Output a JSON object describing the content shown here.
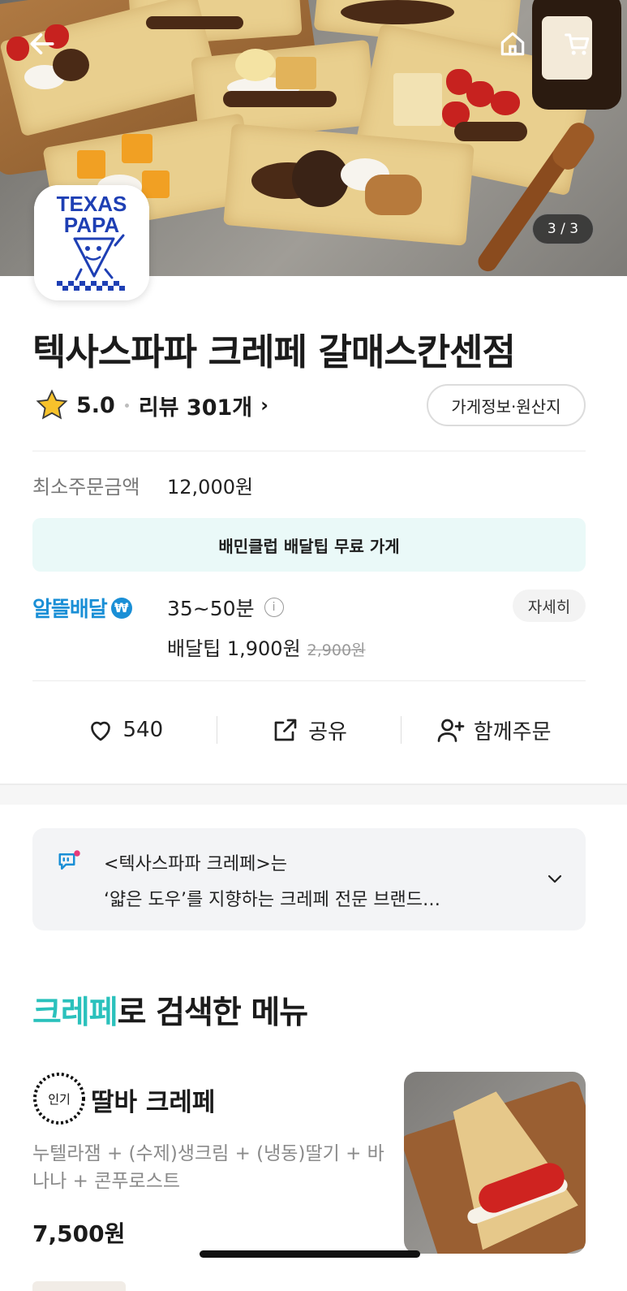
{
  "hero": {
    "page_counter": "3 / 3",
    "back_icon": "arrow-left-icon",
    "home_icon": "home-icon",
    "cart_icon": "cart-icon"
  },
  "store": {
    "logo_text_line1": "TEXAS",
    "logo_text_line2": "PAPA",
    "name": "텍사스파파 크레페 갈매스칸센점",
    "rating": "5.0",
    "reviews_label": "리뷰 301개",
    "info_button": "가게정보·원산지"
  },
  "order": {
    "min_order_label": "최소주문금액",
    "min_order_value": "12,000원",
    "club_banner": "배민클럽 배달팁 무료 가게",
    "delivery_type": "알뜰배달",
    "delivery_time": "35~50분",
    "delivery_fee_label": "배달팁 1,900원",
    "delivery_fee_original": "2,900원",
    "detail_button": "자세히"
  },
  "actions": {
    "like_count": "540",
    "share_label": "공유",
    "group_order_label": "함께주문"
  },
  "notice": {
    "line1": "<텍사스파파 크레페>는",
    "line2": "‘얇은 도우’를 지향하는 크레페 전문 브랜드…"
  },
  "search_section": {
    "keyword": "크레페",
    "suffix": "로 검색한 메뉴"
  },
  "menu": {
    "badge": "인기",
    "name": "딸바 크레페",
    "description": "누텔라잼 + (수제)생크림 + (냉동)딸기 + 바나나 + 콘푸로스트",
    "price": "7,500원"
  },
  "colors": {
    "accent": "#2ac1bc",
    "delivery_blue": "#1a8fd6",
    "banner_bg": "#eaf9f8",
    "logo_blue": "#1e3fb4"
  }
}
